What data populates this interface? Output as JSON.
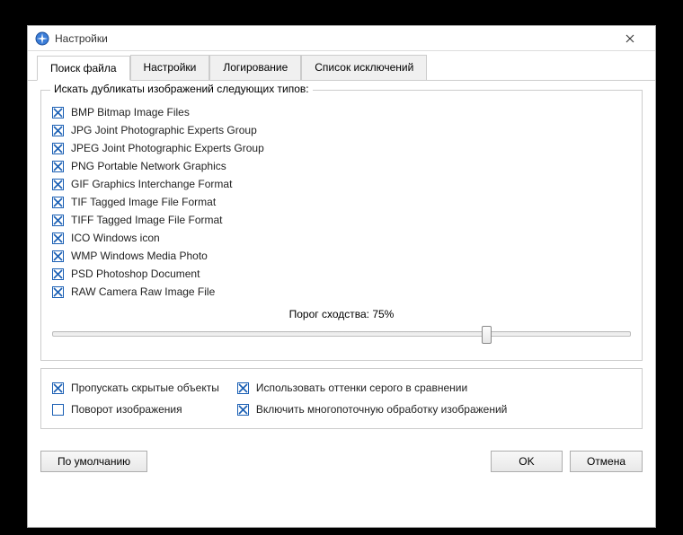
{
  "window": {
    "title": "Настройки"
  },
  "tabs": [
    {
      "label": "Поиск файла",
      "active": true
    },
    {
      "label": "Настройки",
      "active": false
    },
    {
      "label": "Логирование",
      "active": false
    },
    {
      "label": "Список исключений",
      "active": false
    }
  ],
  "group": {
    "label": "Искать дубликаты изображений следующих типов:"
  },
  "filetypes": [
    {
      "label": "BMP  Bitmap Image Files",
      "checked": true
    },
    {
      "label": "JPG  Joint Photographic Experts Group",
      "checked": true
    },
    {
      "label": "JPEG  Joint Photographic Experts Group",
      "checked": true
    },
    {
      "label": "PNG  Portable Network Graphics",
      "checked": true
    },
    {
      "label": "GIF  Graphics Interchange Format",
      "checked": true
    },
    {
      "label": "TIF  Tagged Image File Format",
      "checked": true
    },
    {
      "label": "TIFF  Tagged Image File Format",
      "checked": true
    },
    {
      "label": "ICO  Windows icon",
      "checked": true
    },
    {
      "label": "WMP  Windows Media Photo",
      "checked": true
    },
    {
      "label": "PSD  Photoshop Document",
      "checked": true
    },
    {
      "label": "RAW  Camera Raw Image File",
      "checked": true
    }
  ],
  "threshold": {
    "label": "Порог сходства: 75%",
    "value": 75
  },
  "options": {
    "left": [
      {
        "label": "Пропускать скрытые объекты",
        "checked": true
      },
      {
        "label": "Поворот изображения",
        "checked": false
      }
    ],
    "right": [
      {
        "label": "Использовать оттенки серого в сравнении",
        "checked": true
      },
      {
        "label": "Включить многопоточную обработку изображений",
        "checked": true
      }
    ]
  },
  "footer": {
    "defaults": "По умолчанию",
    "ok": "OK",
    "cancel": "Отмена"
  }
}
